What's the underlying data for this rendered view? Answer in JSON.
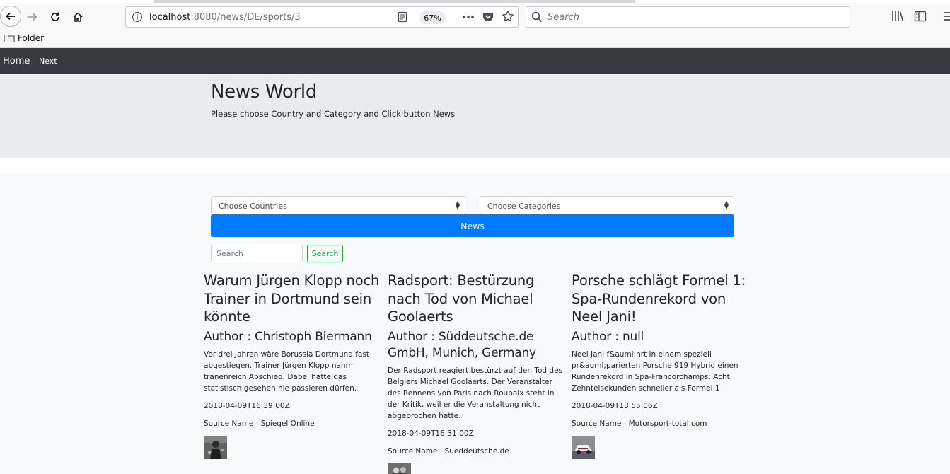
{
  "browser": {
    "url_host": "localhost",
    "url_rest": ":8080/news/DE/sports/3",
    "zoom": "67%",
    "search_placeholder": "Search",
    "bookmark_folder": "Folder"
  },
  "navbar": {
    "home": "Home",
    "next": "Next"
  },
  "jumbotron": {
    "title": "News World",
    "subtitle": "Please choose Country and Category and Click button News"
  },
  "filters": {
    "country_select": "Choose Countries",
    "category_select": "Choose Categories",
    "news_button": "News",
    "search_placeholder": "Search",
    "search_button": "Search"
  },
  "articles": [
    {
      "title": "Warum Jürgen Klopp noch Trainer in Dortmund sein könnte",
      "author": "Author : Christoph Biermann",
      "description": "Vor drei Jahren wäre Borussia Dortmund fast abgestiegen. Trainer Jürgen Klopp nahm tränenreich Abschied. Dabei hätte das statistisch gesehen nie passieren dürfen.",
      "date": "2018-04-09T16:39:00Z",
      "source": "Source Name : Spiegel Online"
    },
    {
      "title": "Radsport: Bestürzung nach Tod von Michael Goolaerts",
      "author": "Author : Süddeutsche.de GmbH, Munich, Germany",
      "description": "Der Radsport reagiert bestürzt auf den Tod des Belgiers Michael Goolaerts. Der Veranstalter des Rennens von Paris nach Roubaix steht in der Kritik, weil er die Veranstaltung nicht abgebrochen hatte.",
      "date": "2018-04-09T16:31:00Z",
      "source": "Source Name : Sueddeutsche.de"
    },
    {
      "title": "Porsche schlägt Formel 1: Spa-Rundenrekord von Neel Jani!",
      "author": "Author : null",
      "description": "Neel Jani f&auml;hrt in einem speziell pr&auml;parierten Porsche 919 Hybrid einen Rundenrekord in Spa-Francorchamps: Acht Zehntelsekunden schneller als Formel 1",
      "date": "2018-04-09T13:55:06Z",
      "source": "Source Name : Motorsport-total.com"
    }
  ]
}
